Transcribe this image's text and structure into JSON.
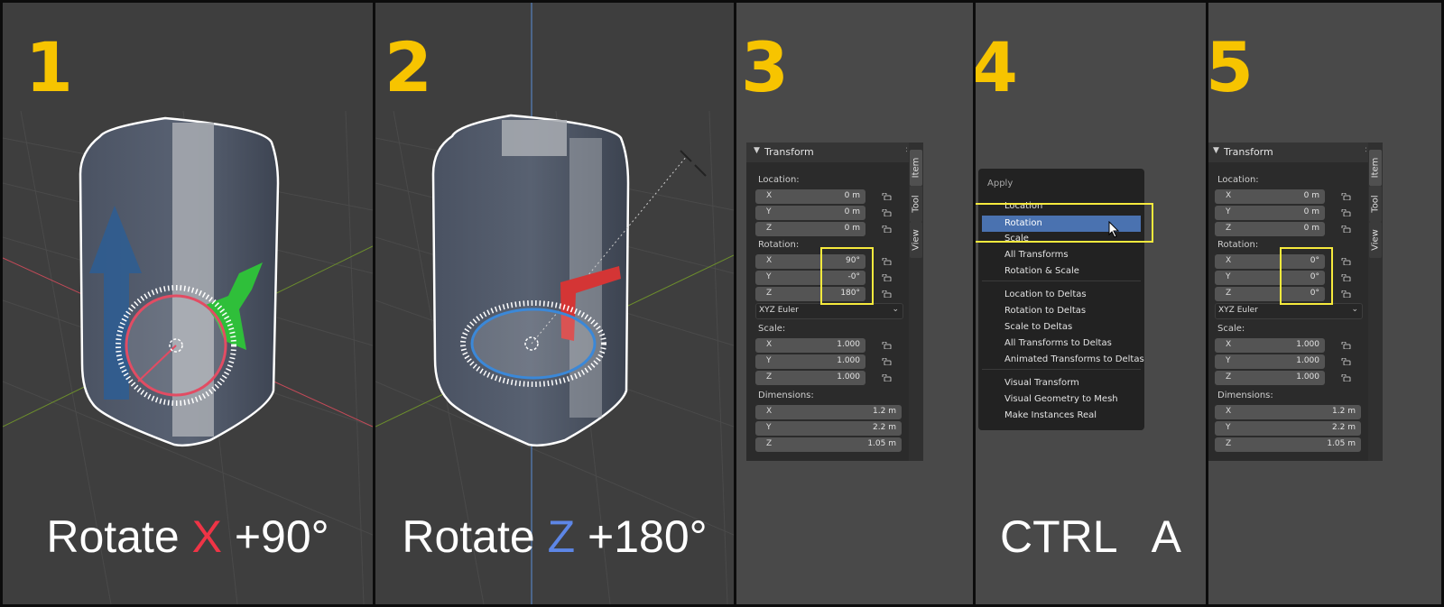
{
  "steps": [
    {
      "number": "1",
      "caption_pre": "Rotate ",
      "caption_axis": "X",
      "caption_post": " +90°"
    },
    {
      "number": "2",
      "caption_pre": "Rotate ",
      "caption_axis": "Z",
      "caption_post": " +180°"
    },
    {
      "number": "3"
    },
    {
      "number": "4",
      "caption": "CTRL   A"
    },
    {
      "number": "5"
    }
  ],
  "colors": {
    "step_number": "#f7c400",
    "axis_x": "#ef3446",
    "axis_z": "#5d86e6",
    "highlight": "#f7ea3d",
    "menu_active": "#4a72b0"
  },
  "transform_before": {
    "title": "Transform",
    "location_label": "Location:",
    "location": [
      {
        "axis": "X",
        "value": "0 m"
      },
      {
        "axis": "Y",
        "value": "0 m"
      },
      {
        "axis": "Z",
        "value": "0 m"
      }
    ],
    "rotation_label": "Rotation:",
    "rotation": [
      {
        "axis": "X",
        "value": "90°"
      },
      {
        "axis": "Y",
        "value": "-0°"
      },
      {
        "axis": "Z",
        "value": "180°"
      }
    ],
    "rotation_mode": "XYZ Euler",
    "scale_label": "Scale:",
    "scale": [
      {
        "axis": "X",
        "value": "1.000"
      },
      {
        "axis": "Y",
        "value": "1.000"
      },
      {
        "axis": "Z",
        "value": "1.000"
      }
    ],
    "dimensions_label": "Dimensions:",
    "dimensions": [
      {
        "axis": "X",
        "value": "1.2 m"
      },
      {
        "axis": "Y",
        "value": "2.2 m"
      },
      {
        "axis": "Z",
        "value": "1.05 m"
      }
    ],
    "tabs": [
      "Item",
      "Tool",
      "View"
    ]
  },
  "transform_after": {
    "title": "Transform",
    "location_label": "Location:",
    "location": [
      {
        "axis": "X",
        "value": "0 m"
      },
      {
        "axis": "Y",
        "value": "0 m"
      },
      {
        "axis": "Z",
        "value": "0 m"
      }
    ],
    "rotation_label": "Rotation:",
    "rotation": [
      {
        "axis": "X",
        "value": "0°"
      },
      {
        "axis": "Y",
        "value": "0°"
      },
      {
        "axis": "Z",
        "value": "0°"
      }
    ],
    "rotation_mode": "XYZ Euler",
    "scale_label": "Scale:",
    "scale": [
      {
        "axis": "X",
        "value": "1.000"
      },
      {
        "axis": "Y",
        "value": "1.000"
      },
      {
        "axis": "Z",
        "value": "1.000"
      }
    ],
    "dimensions_label": "Dimensions:",
    "dimensions": [
      {
        "axis": "X",
        "value": "1.2 m"
      },
      {
        "axis": "Y",
        "value": "2.2 m"
      },
      {
        "axis": "Z",
        "value": "1.05 m"
      }
    ],
    "tabs": [
      "Item",
      "Tool",
      "View"
    ]
  },
  "apply_menu": {
    "title": "Apply",
    "items": [
      "Location",
      "Rotation",
      "Scale",
      "All Transforms",
      "Rotation & Scale",
      "Location to Deltas",
      "Rotation to Deltas",
      "Scale to Deltas",
      "All Transforms to Deltas",
      "Animated Transforms to Deltas",
      "Visual Transform",
      "Visual Geometry to Mesh",
      "Make Instances Real"
    ],
    "selected": "Rotation"
  }
}
